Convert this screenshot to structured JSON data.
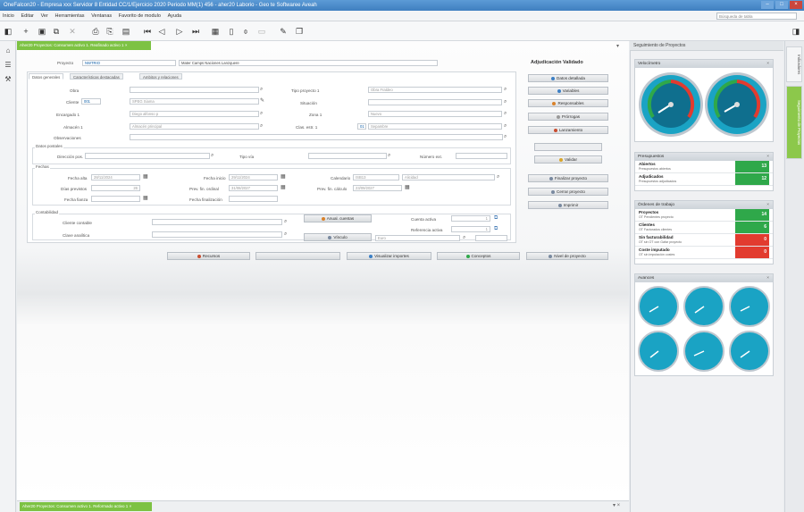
{
  "window": {
    "title": "OneFalcon20 - Empresa xxx Servidor 8 Entidad CC/1/Ejercicio 2020 Periodo MM(1) 456 - aher20 Laborio - Geo te Softwaree Aveah"
  },
  "menu": [
    "Inicio",
    "Editar",
    "Ver",
    "Herramientas",
    "Ventanas",
    "Favorito de modulo",
    "Ayuda"
  ],
  "search": {
    "placeholder": "Búsqueda de tabla"
  },
  "main": {
    "doc_tab": "Aher20 Proyectos: Consumen activo 1. Reafinado activo 1",
    "bottom_tab": "Aher20 Proyectos: Consumen activo 1. Reformado activo 1",
    "header": {
      "proyecto_label": "Proyecto",
      "proyecto_code": "NWTRIO",
      "proyecto_name": "Mater Camps Naciones Lanzquere",
      "status": "Adjudicación Validado"
    },
    "subtabs": [
      "Datos generales",
      "Características destacadas",
      "Ambitos y relaciones"
    ],
    "fields": {
      "obra": "Obra",
      "cliente": "Cliente",
      "cliente_code": "001",
      "cliente_val": "SPEG Siama",
      "encargado": "Encargado 1",
      "encargado_val": "Diego alfonso p",
      "almacen": "Almacén 1",
      "almacen_val": "Almacén principal",
      "tipo_proyecto": "Tipo proyecto 1",
      "tipo_proyecto_val": "Obra Fraldeo",
      "situacion": "Situación",
      "zona": "Zona 1",
      "zona_val": "Nuevo",
      "clas_estr": "Clas. estr. 1",
      "clas_estr_code": "01",
      "clas_estr_val": "Sepambre",
      "observaciones": "Observaciones"
    },
    "datos_postales": {
      "title": "Datos postales",
      "direccion": "Dirección pos.",
      "tipo_via": "Tipo vía",
      "numero": "Número ext."
    },
    "fechas": {
      "title": "Fechas",
      "fecha_alta": "Fecha alta",
      "fecha_alta_val": "28/11/2024",
      "fecha_inicio": "Fecha inicio",
      "fecha_inicio_val": "29/11/2024",
      "calendario": "Calendario",
      "calendario_val": "ISB13",
      "calendario_extra": "Alicidad",
      "dias_previstos": "Días previstos",
      "dias_previstos_val": "26",
      "prev_fin_ordinal": "Prev. fin. ordinal",
      "prev_fin_ordinal_val": "31/08/2027",
      "prev_fin_calculo": "Prev. fin. cálculo",
      "prev_fin_calculo_val": "23/09/2027",
      "fecha_fianza": "Fecha fianza",
      "fecha_finalizacion": "Fecha finalización"
    },
    "contabilidad": {
      "title": "Contabilidad",
      "cliente_contable": "Cliente contable",
      "clave_analitica": "Clave analítica",
      "anual_cuentas": "Anual. cuentas",
      "vinculo": "Vínculo",
      "cuenta_activa": "Cuenta activa",
      "referencia_activa": "Referencia activa",
      "cuenta_activa_val": "1",
      "referencia_activa_val": "1",
      "euro": "Euro"
    },
    "actions_right": [
      "Datos detallada",
      "Variables",
      "Responsables",
      "Prórrogas",
      "Lanzamiento",
      "",
      "Validar",
      "Finalizar proyecto",
      "Cerrar proyecto",
      "Imprimir"
    ],
    "actions_bottom": [
      "Recursos",
      "",
      "Visualizar importes",
      "Conceptos",
      "Nivel de proyecto"
    ]
  },
  "right_panel": {
    "title": "Seguimiento de Proyectos",
    "widgets": {
      "gauges_title": "Velocímetro",
      "presupuestos": {
        "title": "Presupuestos",
        "rows": [
          {
            "title": "Abiertos",
            "sub": "Presupuestos abiertos",
            "value": "13"
          },
          {
            "title": "Adjudicados",
            "sub": "Presupuestos adjudicados",
            "value": "12"
          }
        ]
      },
      "ordenes": {
        "title": "Órdenes de trabajo",
        "rows": [
          {
            "title": "Proyectos",
            "sub": "OT Pendientes proyecto",
            "value": "14"
          },
          {
            "title": "Clientes",
            "sub": "OT Facturados clientes",
            "value": "6"
          },
          {
            "title": "Sin facturabilidad",
            "sub": "OT sin OT con Gafar proyecto",
            "value": "0"
          },
          {
            "title": "Coste imputado",
            "sub": "OT sin imputación costes",
            "value": "0"
          }
        ]
      },
      "avances": {
        "title": "Avances"
      }
    },
    "vertical_tabs": [
      "Indicadores",
      "Seguimiento de Proyectos"
    ]
  }
}
